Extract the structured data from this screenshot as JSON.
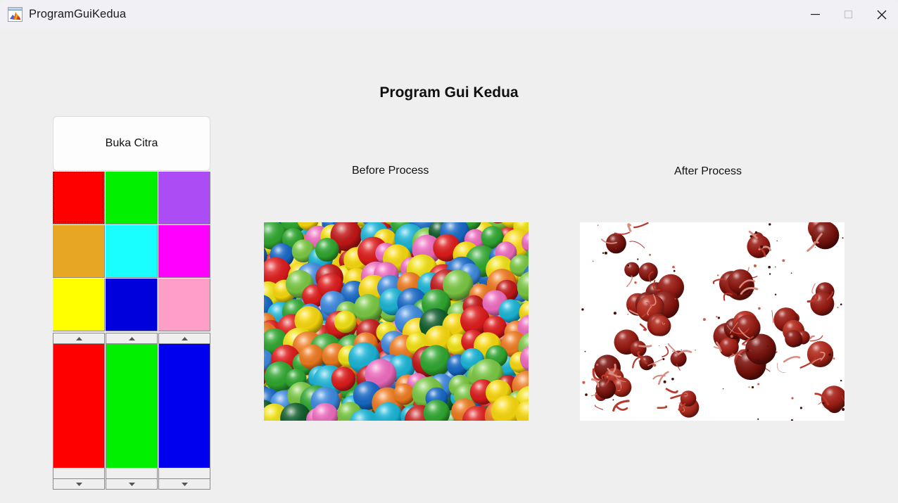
{
  "window": {
    "title": "ProgramGuiKedua",
    "icon": "matlab-icon",
    "controls": {
      "minimize": "minimize-icon",
      "maximize": "maximize-icon",
      "close": "close-icon"
    },
    "titlebar_color": "#f1f0f5",
    "background_color": "#efefef"
  },
  "page": {
    "heading": "Program Gui Kedua"
  },
  "controls": {
    "open_image_label": "Buka Citra",
    "swatches": [
      {
        "name": "swatch-red",
        "color": "#ff0000",
        "focused": true
      },
      {
        "name": "swatch-green",
        "color": "#00f000",
        "focused": false
      },
      {
        "name": "swatch-purple",
        "color": "#ac4cf5",
        "focused": false
      },
      {
        "name": "swatch-orange",
        "color": "#e8a723",
        "focused": false
      },
      {
        "name": "swatch-cyan",
        "color": "#19ffff",
        "focused": false
      },
      {
        "name": "swatch-magenta",
        "color": "#ff00ff",
        "focused": false
      },
      {
        "name": "swatch-yellow",
        "color": "#ffff00",
        "focused": false
      },
      {
        "name": "swatch-blue",
        "color": "#0000dd",
        "focused": false
      },
      {
        "name": "swatch-pink",
        "color": "#ff9fc8",
        "focused": false
      }
    ],
    "sliders": [
      {
        "name": "slider-red",
        "color": "#ff0000",
        "up_icon": "caret-up-icon",
        "down_icon": "caret-down-icon"
      },
      {
        "name": "slider-green",
        "color": "#00f000",
        "up_icon": "caret-up-icon",
        "down_icon": "caret-down-icon"
      },
      {
        "name": "slider-blue",
        "color": "#0000ee",
        "up_icon": "caret-up-icon",
        "down_icon": "caret-down-icon"
      }
    ]
  },
  "images": {
    "before": {
      "caption": "Before Process",
      "description": "photo of a dense pile of multicolored plastic balls"
    },
    "after": {
      "caption": "After Process",
      "description": "red channel segmentation result: dark red blobs on white background"
    }
  }
}
